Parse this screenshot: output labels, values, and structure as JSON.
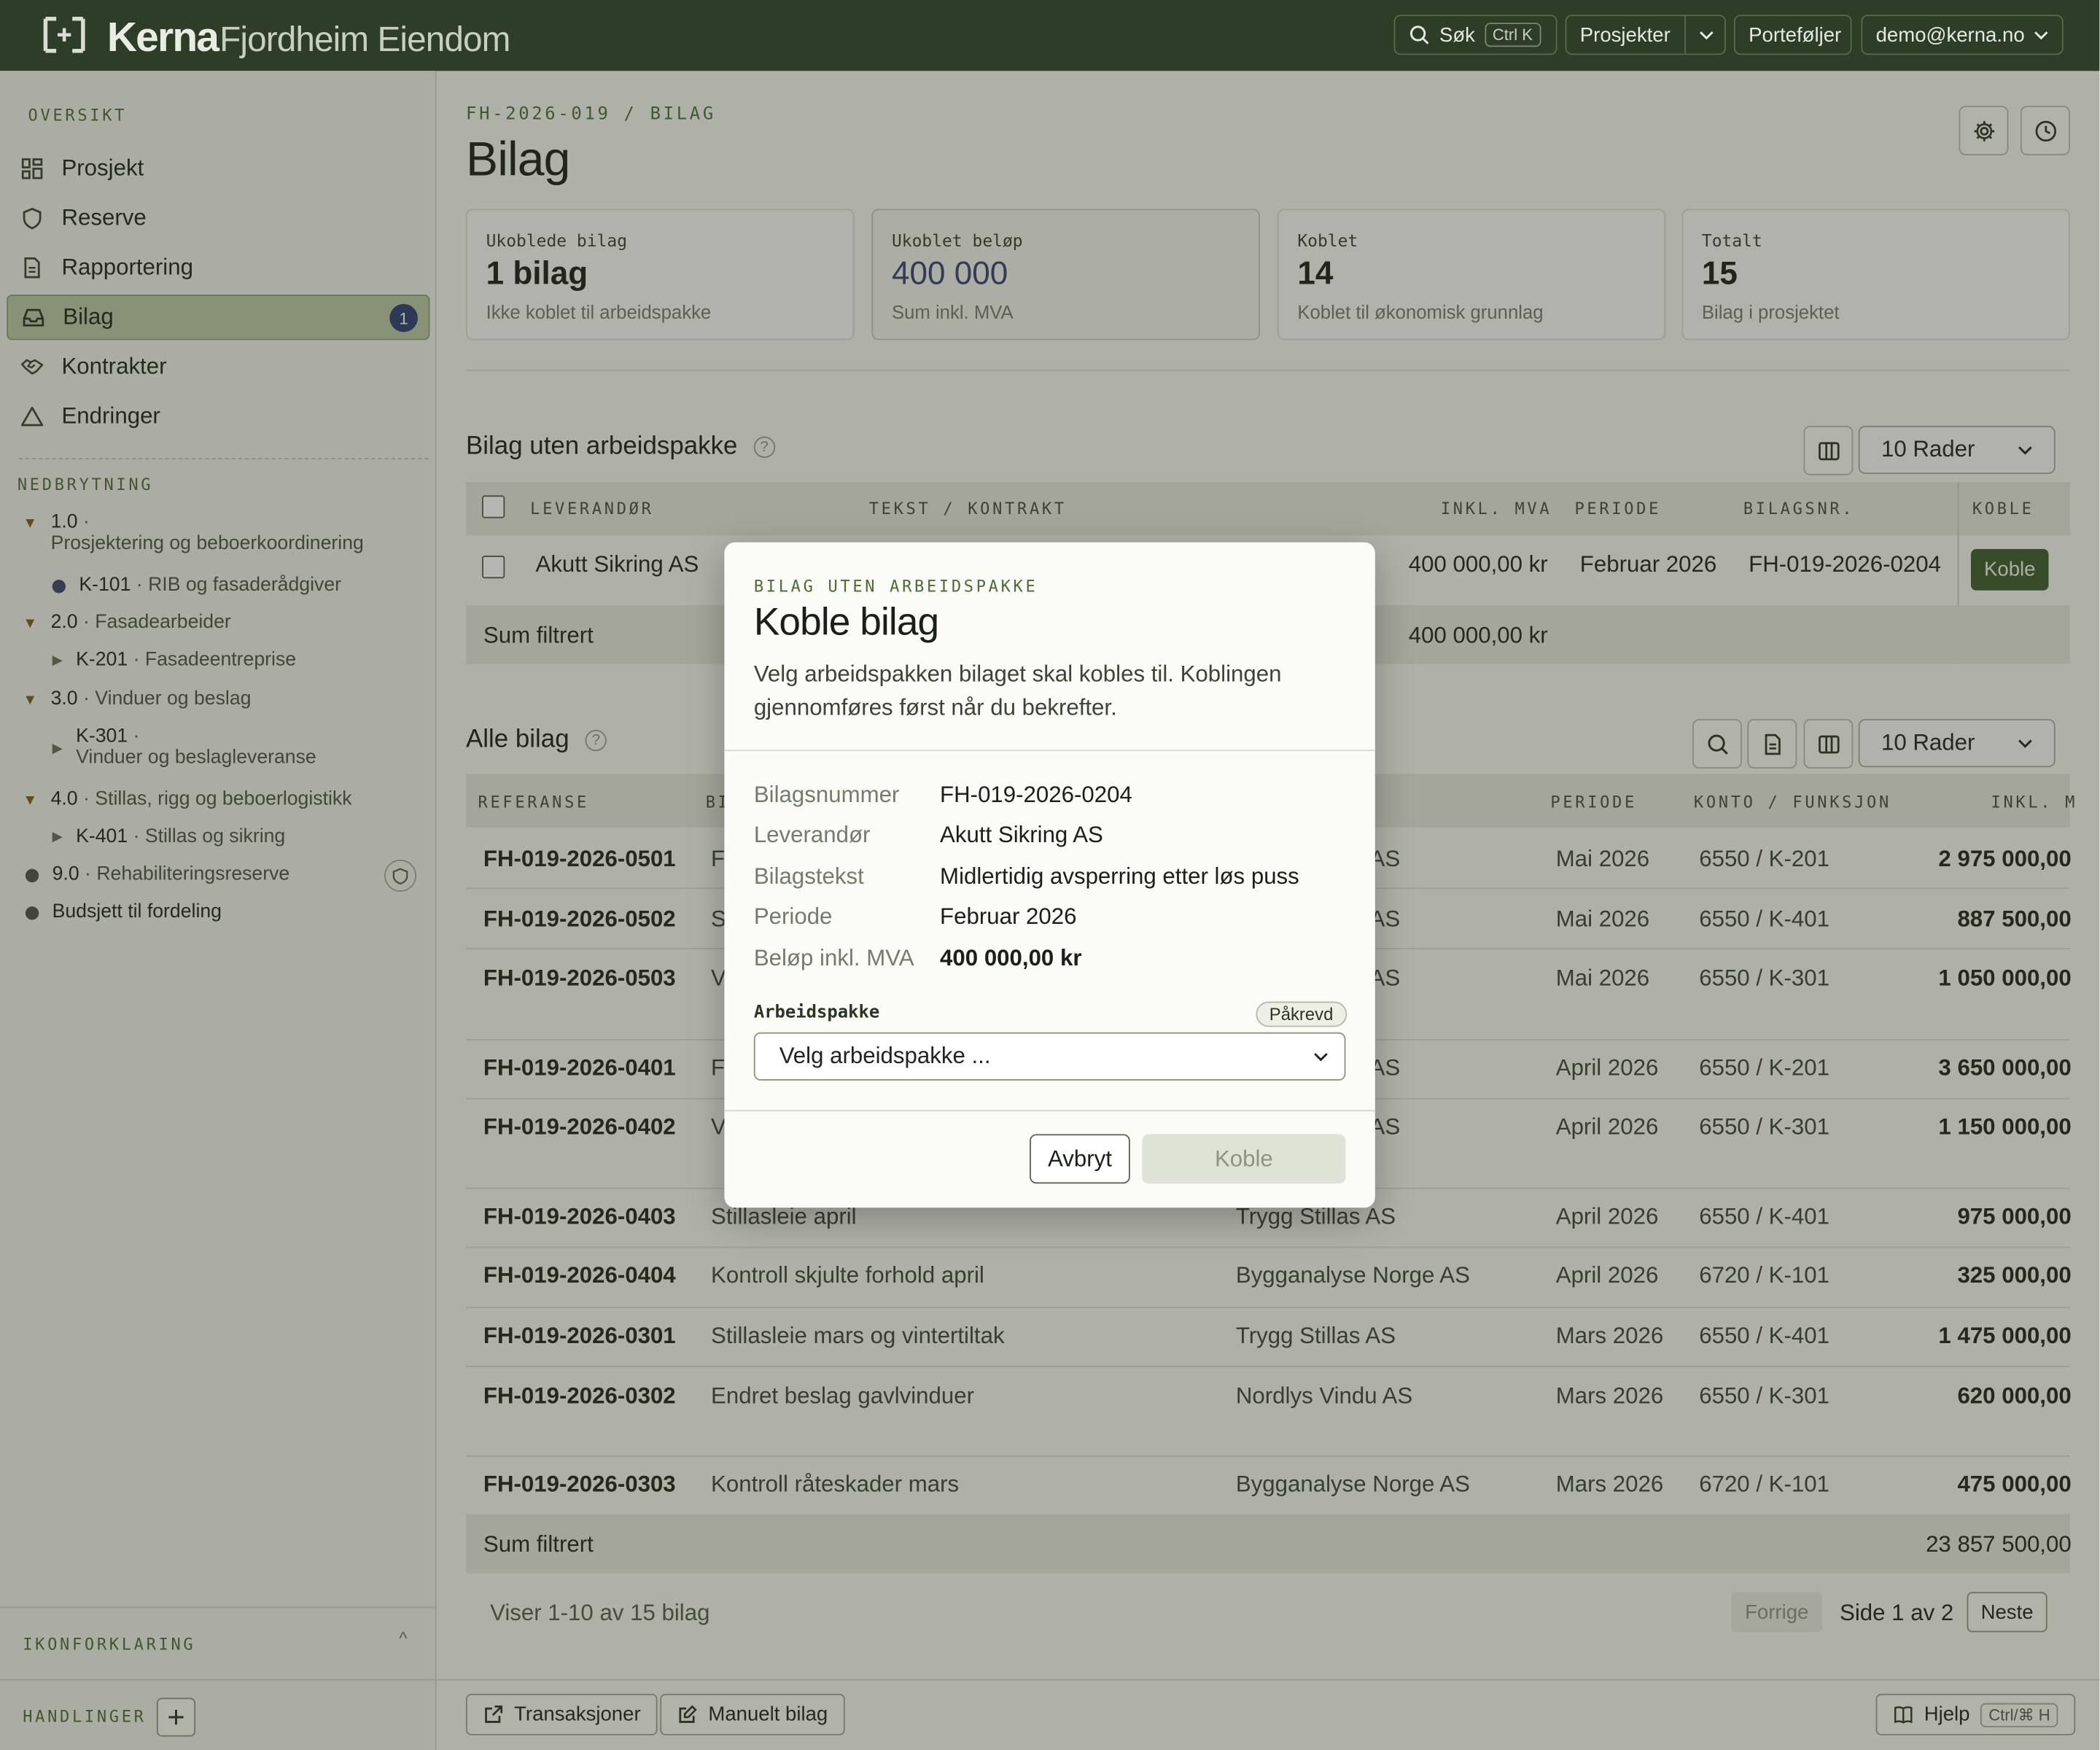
{
  "topbar": {
    "brand": "Kerna",
    "org": "Fjordheim Eiendom",
    "search_label": "Søk",
    "search_kbd": "Ctrl K",
    "projects_label": "Prosjekter",
    "portfolios_label": "Porteføljer",
    "user_email": "demo@kerna.no"
  },
  "sidebar": {
    "overview_heading": "OVERSIKT",
    "items": [
      {
        "label": "Prosjekt",
        "icon": "grid-icon"
      },
      {
        "label": "Reserve",
        "icon": "shield-icon"
      },
      {
        "label": "Rapportering",
        "icon": "document-icon"
      },
      {
        "label": "Bilag",
        "icon": "inbox-icon",
        "badge": "1",
        "active": true
      },
      {
        "label": "Kontrakter",
        "icon": "handshake-icon"
      },
      {
        "label": "Endringer",
        "icon": "triangle-icon"
      }
    ],
    "breakdown_heading": "NEDBRYTNING",
    "tree": {
      "n1": {
        "code": "1.0",
        "name": "Prosjektering og beboerkoordinering"
      },
      "k101": {
        "code": "K-101",
        "name": "RIB og fasaderådgiver"
      },
      "n2": {
        "code": "2.0",
        "name": "Fasadearbeider"
      },
      "k201": {
        "code": "K-201",
        "name": "Fasadeentreprise"
      },
      "n3": {
        "code": "3.0",
        "name": "Vinduer og beslag"
      },
      "k301": {
        "code": "K-301",
        "name": "Vinduer og beslagleveranse"
      },
      "n4": {
        "code": "4.0",
        "name": "Stillas, rigg og beboerlogistikk"
      },
      "k401": {
        "code": "K-401",
        "name": "Stillas og sikring"
      },
      "n9": {
        "code": "9.0",
        "name": "Rehabiliteringsreserve"
      },
      "budget": "Budsjett til fordeling"
    },
    "legend_heading": "IKONFORKLARING",
    "actions_heading": "HANDLINGER"
  },
  "main": {
    "breadcrumb": "FH-2026-019 / BILAG",
    "title": "Bilag",
    "stats": [
      {
        "label": "Ukoblede bilag",
        "value": "1 bilag",
        "sub": "Ikke koblet til arbeidspakke"
      },
      {
        "label": "Ukoblet beløp",
        "value": "400 000",
        "sub": "Sum inkl. MVA"
      },
      {
        "label": "Koblet",
        "value": "14",
        "sub": "Koblet til økonomisk grunnlag"
      },
      {
        "label": "Totalt",
        "value": "15",
        "sub": "Bilag i prosjektet"
      }
    ],
    "unlinked": {
      "title": "Bilag uten arbeidspakke",
      "rows_select": "10 Rader",
      "headers": {
        "supplier": "LEVERANDØR",
        "text": "TEKST / KONTRAKT",
        "amount": "INKL. MVA",
        "period": "PERIODE",
        "number": "BILAGSNR.",
        "link": "KOBLE"
      },
      "row": {
        "supplier": "Akutt Sikring AS",
        "amount": "400 000,00 kr",
        "period": "Februar 2026",
        "number": "FH-019-2026-0204",
        "link_label": "Koble"
      },
      "sum_label": "Sum filtrert",
      "sum_value": "400 000,00 kr"
    },
    "all": {
      "title": "Alle bilag",
      "rows_select": "10 Rader",
      "headers": {
        "ref": "REFERANSE",
        "text": "BI",
        "period": "PERIODE",
        "account": "KONTO / FUNKSJON",
        "amount": "INKL. M"
      },
      "rows": [
        {
          "ref": "FH-019-2026-0501",
          "text": "F",
          "supplier": "AS",
          "period": "Mai 2026",
          "account": "6550 / K-201",
          "amount": "2 975 000,00"
        },
        {
          "ref": "FH-019-2026-0502",
          "text": "S",
          "supplier": "AS",
          "period": "Mai 2026",
          "account": "6550 / K-401",
          "amount": "887 500,00"
        },
        {
          "ref": "FH-019-2026-0503",
          "text": "V",
          "supplier": "AS",
          "period": "Mai 2026",
          "account": "6550 / K-301",
          "amount": "1 050 000,00"
        },
        {
          "ref": "FH-019-2026-0401",
          "text": "F",
          "supplier": "AS",
          "period": "April 2026",
          "account": "6550 / K-201",
          "amount": "3 650 000,00"
        },
        {
          "ref": "FH-019-2026-0402",
          "text": "V",
          "supplier": "AS",
          "period": "April 2026",
          "account": "6550 / K-301",
          "amount": "1 150 000,00"
        },
        {
          "ref": "FH-019-2026-0403",
          "text": "Stillasleie april",
          "supplier": "Trygg Stillas AS",
          "period": "April 2026",
          "account": "6550 / K-401",
          "amount": "975 000,00"
        },
        {
          "ref": "FH-019-2026-0404",
          "text": "Kontroll skjulte forhold april",
          "supplier": "Bygganalyse Norge AS",
          "period": "April 2026",
          "account": "6720 / K-101",
          "amount": "325 000,00"
        },
        {
          "ref": "FH-019-2026-0301",
          "text": "Stillasleie mars og vintertiltak",
          "supplier": "Trygg Stillas AS",
          "period": "Mars 2026",
          "account": "6550 / K-401",
          "amount": "1 475 000,00"
        },
        {
          "ref": "FH-019-2026-0302",
          "text": "Endret beslag gavlvinduer",
          "supplier": "Nordlys Vindu AS",
          "period": "Mars 2026",
          "account": "6550 / K-301",
          "amount": "620 000,00"
        },
        {
          "ref": "FH-019-2026-0303",
          "text": "Kontroll råteskader mars",
          "supplier": "Bygganalyse Norge AS",
          "period": "Mars 2026",
          "account": "6720 / K-101",
          "amount": "475 000,00"
        }
      ],
      "sum_label": "Sum filtrert",
      "sum_value": "23 857 500,00",
      "showing": "Viser 1-10 av 15 bilag",
      "prev": "Forrige",
      "page": "Side 1 av 2",
      "next": "Neste"
    }
  },
  "footer": {
    "transactions": "Transaksjoner",
    "manual": "Manuelt bilag",
    "help": "Hjelp",
    "help_kbd": "Ctrl/⌘ H"
  },
  "modal": {
    "kicker": "BILAG UTEN ARBEIDSPAKKE",
    "title": "Koble bilag",
    "description": "Velg arbeidspakken bilaget skal kobles til. Koblingen gjennomføres først når du bekrefter.",
    "fields": [
      {
        "label": "Bilagsnummer",
        "value": "FH-019-2026-0204"
      },
      {
        "label": "Leverandør",
        "value": "Akutt Sikring AS"
      },
      {
        "label": "Bilagstekst",
        "value": "Midlertidig avsperring etter løs puss"
      },
      {
        "label": "Periode",
        "value": "Februar 2026"
      },
      {
        "label": "Beløp inkl. MVA",
        "value": "400 000,00 kr"
      }
    ],
    "select_label": "Arbeidspakke",
    "required": "Påkrevd",
    "select_placeholder": "Velg arbeidspakke ...",
    "cancel": "Avbryt",
    "confirm": "Koble"
  }
}
